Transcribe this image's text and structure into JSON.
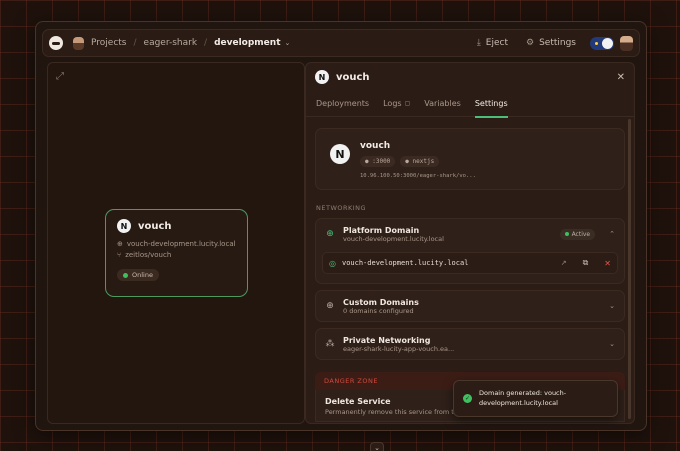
{
  "topbar": {
    "crumbs": [
      "Projects",
      "eager-shark",
      "development"
    ],
    "eject_label": "Eject",
    "settings_label": "Settings"
  },
  "node": {
    "name": "vouch",
    "domain": "vouch-development.lucity.local",
    "repo": "zeitlos/vouch",
    "status": "Online"
  },
  "panel": {
    "title": "vouch",
    "tabs": [
      "Deployments",
      "Logs",
      "Variables",
      "Settings"
    ],
    "active_tab": "Settings",
    "info": {
      "name": "vouch",
      "port": ":3000",
      "framework": "nextjs",
      "address": "10.96.100.50:3000/eager-shark/vo..."
    },
    "networking_label": "NETWORKING",
    "platform_domain": {
      "title": "Platform Domain",
      "sub": "vouch-development.lucity.local",
      "badge": "Active",
      "value": "vouch-development.lucity.local"
    },
    "custom_domains": {
      "title": "Custom Domains",
      "sub": "0 domains configured"
    },
    "private_networking": {
      "title": "Private Networking",
      "sub": "eager-shark-lucity-app-vouch.ea..."
    },
    "danger_label": "DANGER ZONE",
    "delete": {
      "title": "Delete Service",
      "sub": "Permanently remove this service from the p"
    }
  },
  "toast": {
    "line1": "Domain generated: vouch-",
    "line2": "development.lucity.local"
  },
  "colors": {
    "accent_green": "#4bbf78",
    "danger_red": "#d0493c",
    "background": "#1f120c"
  }
}
